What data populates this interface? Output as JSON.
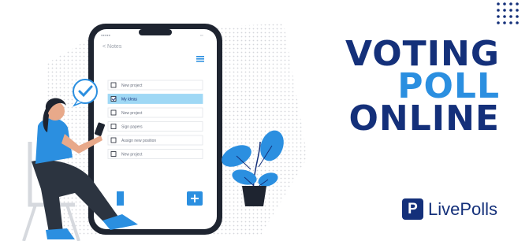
{
  "phone": {
    "back_label": "< Notes",
    "menu_icon": "hamburger-icon",
    "add_icon": "plus-icon",
    "items": [
      {
        "label": "New project",
        "checked": false
      },
      {
        "label": "My ideas",
        "checked": true
      },
      {
        "label": "New project",
        "checked": false
      },
      {
        "label": "Sign papers",
        "checked": false
      },
      {
        "label": "Assign new position",
        "checked": false
      },
      {
        "label": "New project",
        "checked": false
      }
    ]
  },
  "headline": {
    "line1": "VOTING",
    "line2": "POLL",
    "line3": "ONLINE"
  },
  "brand": {
    "name": "LivePolls",
    "logo_letter": "P"
  },
  "colors": {
    "navy": "#14307a",
    "blue": "#2b8fe0",
    "highlight": "#9fd8f5",
    "phone_frame": "#1e2430"
  }
}
